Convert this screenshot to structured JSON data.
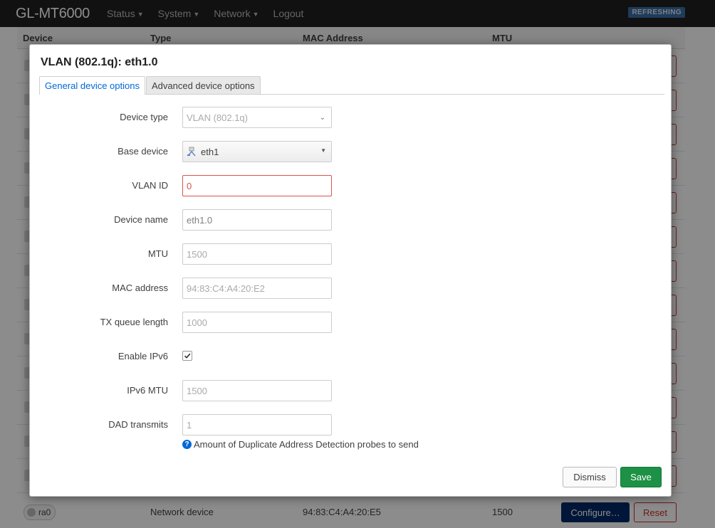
{
  "navbar": {
    "brand": "GL-MT6000",
    "menu": [
      "Status",
      "System",
      "Network"
    ],
    "logout": "Logout",
    "status_badge": "REFRESHING"
  },
  "table": {
    "headers": [
      "Device",
      "Type",
      "MAC Address",
      "MTU"
    ],
    "last_row": {
      "device": "ra0",
      "type": "Network device",
      "mac": "94:83:C4:A4:20:E5",
      "mtu": "1500",
      "configure": "Configure…",
      "reset": "Reset"
    }
  },
  "modal": {
    "title": "VLAN (802.1q): eth1.0",
    "tabs": [
      "General device options",
      "Advanced device options"
    ],
    "fields": {
      "device_type": {
        "label": "Device type",
        "value": "VLAN (802.1q)"
      },
      "base_device": {
        "label": "Base device",
        "value": "eth1",
        "icon": "ethernet-port-icon"
      },
      "vlan_id": {
        "label": "VLAN ID",
        "value": "0"
      },
      "device_name": {
        "label": "Device name",
        "value": "eth1.0"
      },
      "mtu": {
        "label": "MTU",
        "placeholder": "1500"
      },
      "mac_address": {
        "label": "MAC address",
        "placeholder": "94:83:C4:A4:20:E2"
      },
      "tx_queue_length": {
        "label": "TX queue length",
        "placeholder": "1000"
      },
      "enable_ipv6": {
        "label": "Enable IPv6",
        "checked": true
      },
      "ipv6_mtu": {
        "label": "IPv6 MTU",
        "placeholder": "1500"
      },
      "dad_transmits": {
        "label": "DAD transmits",
        "placeholder": "1",
        "hint": "Amount of Duplicate Address Detection probes to send"
      }
    },
    "buttons": {
      "dismiss": "Dismiss",
      "save": "Save"
    }
  },
  "colors": {
    "navbar_bg": "#202020",
    "primary_blue": "#0069d6",
    "save_green": "#1d9145",
    "error_red": "#d9534f",
    "configure_navy": "#002868"
  }
}
